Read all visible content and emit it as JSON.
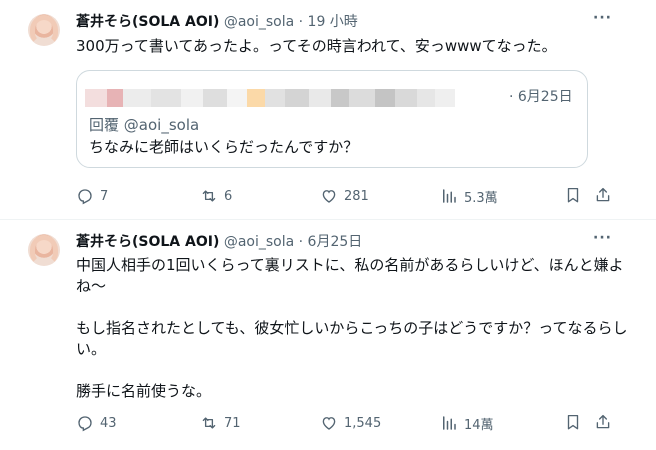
{
  "tweets": [
    {
      "name": "蒼井そら(SOLA AOI)",
      "handle": "@aoi_sola",
      "separator": "·",
      "time": "19 小時",
      "more": "···",
      "text": "300万って書いてあったよ。ってその時言われて、安っwwwてなった。",
      "quote": {
        "time": "· 6月25日",
        "reply_prefix": "回覆",
        "reply_handle": "@aoi_sola",
        "text": "ちなみに老師はいくらだったんですか？"
      },
      "stats": {
        "replies": "7",
        "retweets": "6",
        "likes": "281",
        "views": "5.3萬"
      }
    },
    {
      "name": "蒼井そら(SOLA AOI)",
      "handle": "@aoi_sola",
      "separator": "·",
      "time": "6月25日",
      "more": "···",
      "text": "中国人相手の1回いくらって裏リストに、私の名前があるらしいけど、ほんと嫌よね〜\n\nもし指名されたとしても、彼女忙しいからこっちの子はどうですか？ってなるらしい。\n\n勝手に名前使うな。",
      "stats": {
        "replies": "43",
        "retweets": "71",
        "likes": "1,545",
        "views": "14萬"
      }
    }
  ],
  "colors": {
    "muted": "#536471",
    "text": "#0f1419",
    "border": "#cfd9de"
  },
  "icons": [
    "reply-icon",
    "retweet-icon",
    "like-icon",
    "views-icon",
    "bookmark-icon",
    "share-icon",
    "more-icon"
  ]
}
